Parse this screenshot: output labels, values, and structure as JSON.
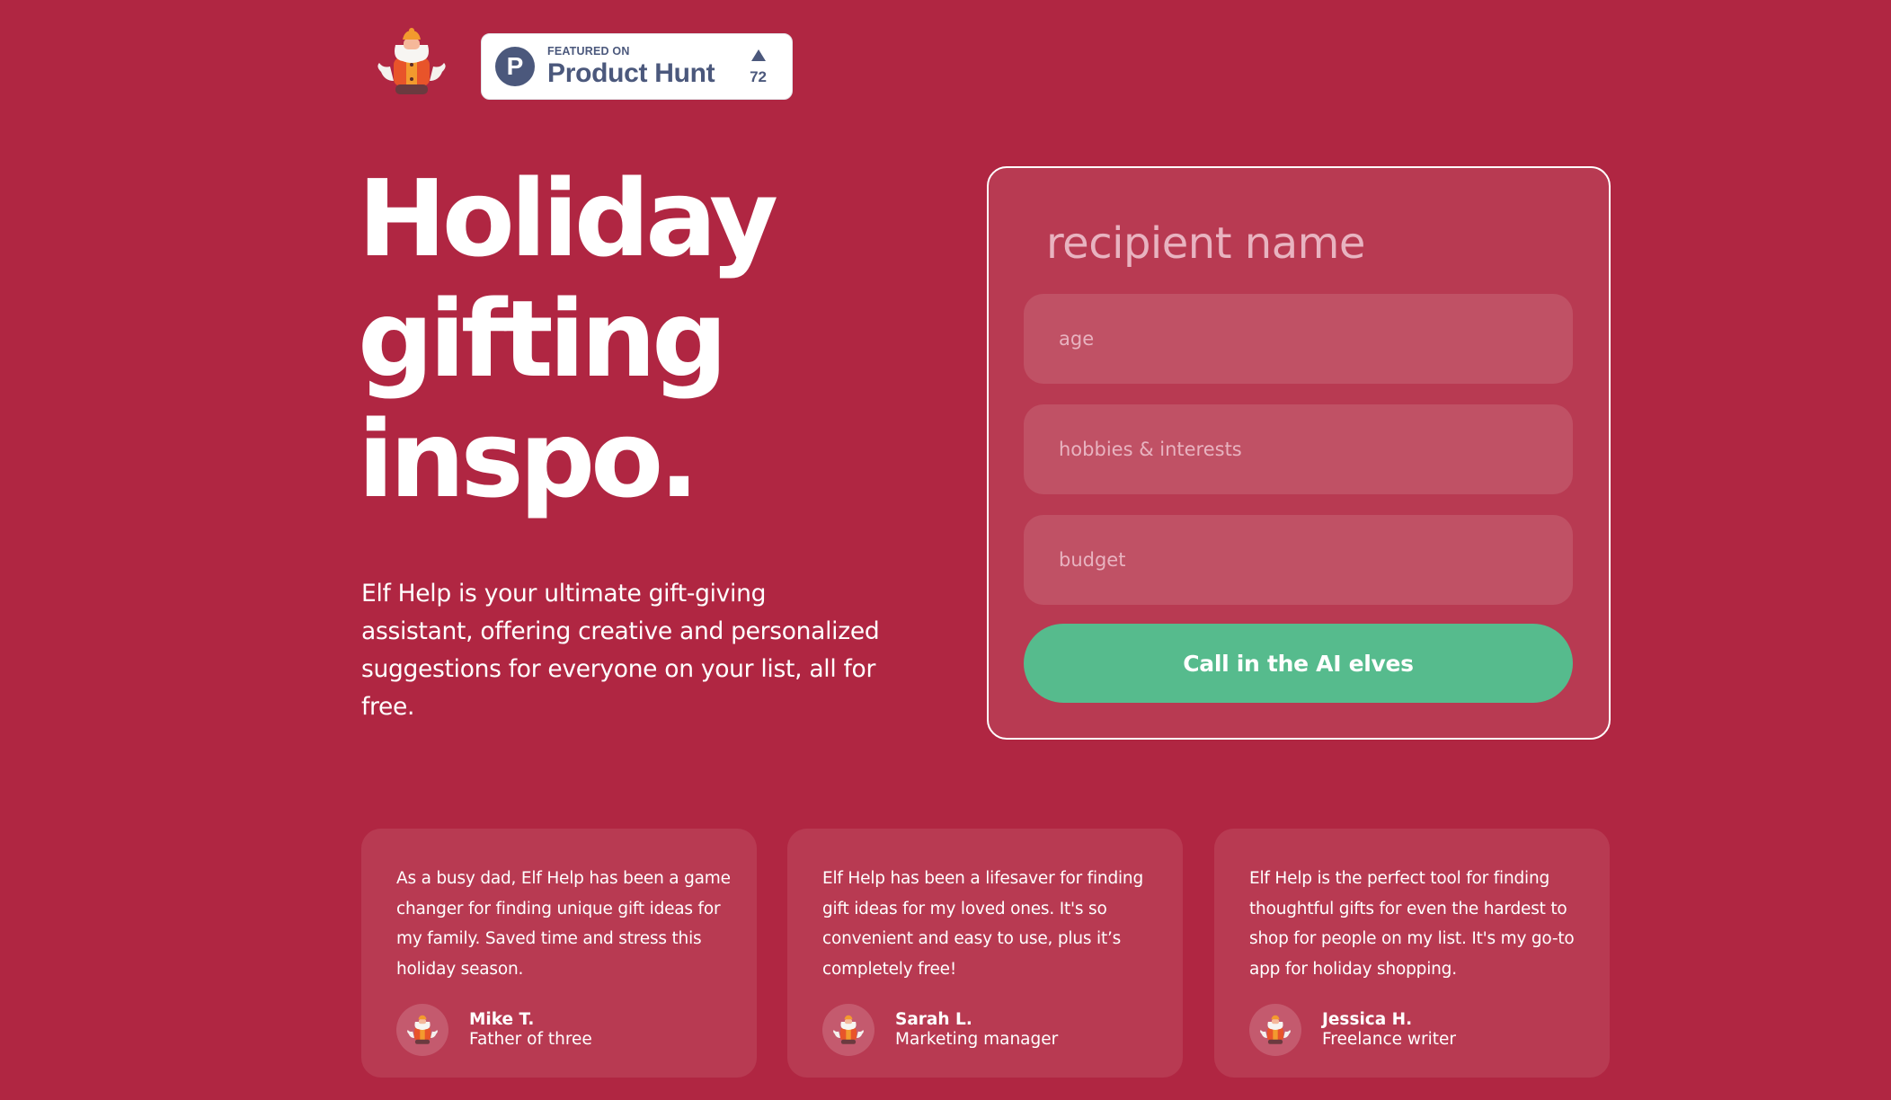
{
  "header": {
    "logo_alt": "Elf Help elf mascot",
    "product_hunt": {
      "featured_label": "FEATURED ON",
      "name": "Product Hunt",
      "logo_letter": "P",
      "upvote_icon": "triangle-up-icon",
      "votes": "72"
    }
  },
  "hero": {
    "headline_lines": [
      "Holiday",
      "gifting",
      "inspo."
    ],
    "description": "Elf Help is your ultimate gift-giving assistant, offering creative and personalized suggestions for everyone on your list, all for free."
  },
  "form": {
    "recipient_placeholder": "recipient name",
    "age_placeholder": "age",
    "hobbies_placeholder": "hobbies & interests",
    "budget_placeholder": "budget",
    "submit_label": "Call in the AI elves"
  },
  "testimonials": [
    {
      "quote": "As a busy dad, Elf Help has been a game changer for finding unique gift ideas for my family. Saved time and stress this holiday season.",
      "name": "Mike T.",
      "role": "Father of three"
    },
    {
      "quote": "Elf Help has been a lifesaver for finding gift ideas for my loved ones. It's so convenient and easy to use, plus it’s completely free!",
      "name": "Sarah L.",
      "role": "Marketing manager"
    },
    {
      "quote": "Elf Help is the perfect tool for finding thoughtful gifts for even the hardest to shop for people on my list. It's my go-to app for holiday shopping.",
      "name": "Jessica H.",
      "role": "Freelance writer"
    }
  ],
  "colors": {
    "background": "#b02642",
    "card": "#b83a52",
    "input": "#c05165",
    "cta": "#56bb8d",
    "product_hunt": "#4b587c",
    "placeholder": "#e8b3c0"
  }
}
